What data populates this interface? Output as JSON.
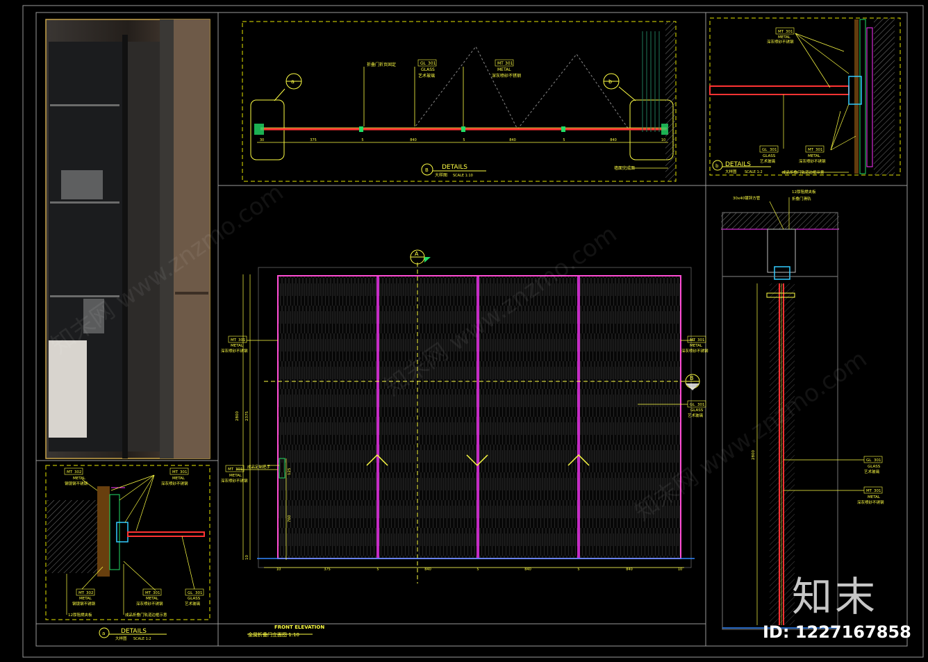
{
  "colors": {
    "frame": "#b8b8b8",
    "yellow": "#ffff44",
    "dash": "#e6e600",
    "magenta": "#ff33ff",
    "red": "#ff3333",
    "green": "#22dd66",
    "cyan": "#33ccff",
    "panel_fill": "#0b0b0b"
  },
  "plan_detail": {
    "callout_left": "a",
    "callout_right": "b",
    "note_fold": "折叠门折页固定",
    "gl_code": "GL",
    "gl_num": "301",
    "gl_en": "GLASS",
    "gl_cn": "艺术玻璃",
    "mt_code": "MT",
    "mt_num": "301",
    "mt_en": "METAL",
    "mt_cn": "深灰喷砂不锈钢",
    "dims": [
      "30",
      "375",
      "5",
      "840",
      "5",
      "840",
      "5",
      "840",
      "10"
    ],
    "wall_note": "墙面完成面",
    "title_mark": "B",
    "title_en": "DETAILS",
    "title_cn": "大样图",
    "scale": "SCALE  1:10"
  },
  "detail_b": {
    "mt_code": "MT",
    "mt_num": "301",
    "mt_en": "METAL",
    "mt_cn": "深灰喷砂不锈钢",
    "gl_code": "GL",
    "gl_num": "301",
    "gl_en": "GLASS",
    "gl_cn": "艺术玻璃",
    "mt2_code": "MT",
    "mt2_num": "301",
    "mt2_en": "METAL",
    "mt2_cn": "深灰喷砂不锈钢",
    "note": "成品折叠门轨道边框示意",
    "title_mark": "b",
    "title_en": "DETAILS",
    "title_cn": "大样图",
    "scale": "SCALE  1:2"
  },
  "detail_a": {
    "mt302_code": "MT",
    "mt302_num": "302",
    "mt302_en": "METAL",
    "mt302_cn": "钢镜钢不锈钢",
    "mt301_code": "MT",
    "mt301_num": "301",
    "mt301_en": "METAL",
    "mt301_cn": "深灰喷砂不锈钢",
    "mt302b_code": "MT",
    "mt302b_num": "302",
    "mt302b_en": "METAL",
    "mt302b_cn": "钢镜钢不锈钢",
    "mt301b_code": "MT",
    "mt301b_num": "301",
    "mt301b_en": "METAL",
    "mt301b_cn": "深灰喷砂不锈钢",
    "gl_code": "GL",
    "gl_num": "301",
    "gl_en": "GLASS",
    "gl_cn": "艺术玻璃",
    "note1": "12厚阻燃夹板",
    "note2": "成品折叠门轨道边框示意",
    "title_mark": "a",
    "title_en": "DETAILS",
    "title_cn": "大样图",
    "scale": "SCALE  1:2"
  },
  "elevation": {
    "marker_a": "A",
    "marker_b": "B",
    "mt_left_code": "MT",
    "mt_left_num": "301",
    "mt_left_en": "METAL",
    "mt_left_cn": "深灰喷砂不锈钢",
    "mt_right_code": "MT",
    "mt_right_num": "301",
    "mt_right_en": "METAL",
    "mt_right_cn": "深灰喷砂不锈钢",
    "gl_code": "GL",
    "gl_num": "301",
    "gl_en": "GLASS",
    "gl_cn": "艺术玻璃",
    "mt_low_code": "MT",
    "mt_low_num": "301",
    "mt_low_en": "METAL",
    "mt_low_cn": "深灰喷砂不锈钢",
    "handle_note": "成品定制把手",
    "dim_total": "2800",
    "dim_upper": "2375",
    "dim_a": "125",
    "dim_b": "760",
    "dim_c": "10",
    "dims_bottom": [
      "10",
      "375",
      "5",
      "840",
      "5",
      "840",
      "5",
      "840",
      "10"
    ],
    "title_en": "FRONT ELEVATION",
    "title_cn": "金属折叠门立面图 1:10"
  },
  "section": {
    "note_top1": "12厚阻燃夹板",
    "note_top2": "30x40镀锌方管",
    "note_top3": "折叠门滑轨",
    "gl_code": "GL",
    "gl_num": "301",
    "gl_en": "GLASS",
    "gl_cn": "艺术玻璃",
    "mt_code": "MT",
    "mt_num": "301",
    "mt_en": "METAL",
    "mt_cn": "深灰喷砂不锈钢",
    "dim": "2800"
  },
  "brand": {
    "logo": "知末",
    "id_text": "ID: 1227167858",
    "watermark": "知末网 www.znzmo.com"
  }
}
